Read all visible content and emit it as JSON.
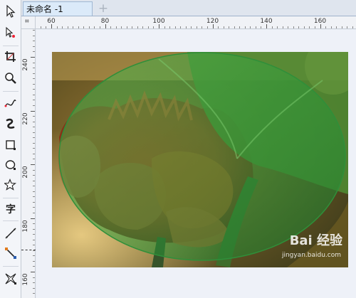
{
  "document": {
    "tab_title": "未命名 -1",
    "new_tab_icon": "plus-icon"
  },
  "toolbox": {
    "tools": [
      "pick-tool-icon",
      "shape-tool-icon",
      "crop-tool-icon",
      "zoom-tool-icon",
      "freehand-tool-icon",
      "artistic-media-icon",
      "rectangle-tool-icon",
      "ellipse-tool-icon",
      "polygon-tool-icon",
      "text-tool-icon",
      "dimension-tool-icon",
      "connector-tool-icon",
      "interactive-effect-icon"
    ],
    "text_tool_label": "字"
  },
  "ruler": {
    "corner_icon": "ruler-origin-icon",
    "horizontal_labels": [
      "60",
      "80",
      "100",
      "120",
      "140",
      "160"
    ],
    "vertical_labels": [
      "240",
      "220",
      "200",
      "180",
      "160"
    ]
  },
  "watermark": {
    "brand": "Bai 经验",
    "sub": "jingyan.baidu.com"
  },
  "colors": {
    "ellipse_fill": "#2e9a3a",
    "ellipse_stroke": "#2f8f3a",
    "tab_active": "#dbeaf9",
    "workspace": "#eef1f8"
  }
}
